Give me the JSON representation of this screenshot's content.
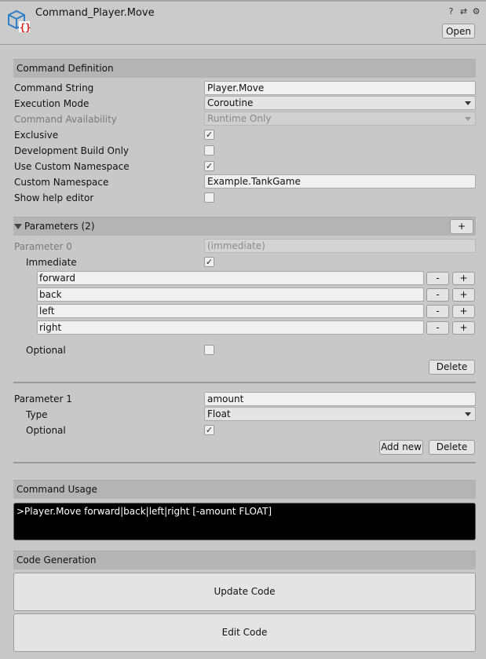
{
  "header": {
    "title": "Command_Player.Move",
    "open_label": "Open",
    "icons": [
      "help-icon",
      "preset-icon",
      "settings-icon"
    ]
  },
  "definition": {
    "section_title": "Command Definition",
    "command_string": {
      "label": "Command String",
      "value": "Player.Move"
    },
    "execution_mode": {
      "label": "Execution Mode",
      "value": "Coroutine"
    },
    "availability": {
      "label": "Command Availability",
      "value": "Runtime Only"
    },
    "exclusive": {
      "label": "Exclusive",
      "checked": true
    },
    "dev_build": {
      "label": "Development Build Only",
      "checked": false
    },
    "use_custom_ns": {
      "label": "Use Custom Namespace",
      "checked": true
    },
    "custom_ns": {
      "label": "Custom Namespace",
      "value": "Example.TankGame"
    },
    "show_help": {
      "label": "Show help editor",
      "checked": false
    }
  },
  "parameters": {
    "section_title": "Parameters (2)",
    "add_label": "+",
    "param0": {
      "label": "Parameter 0",
      "value": "(immediate)",
      "immediate_label": "Immediate",
      "immediate_checked": true,
      "options": [
        "forward",
        "back",
        "left",
        "right"
      ],
      "minus_label": "-",
      "plus_label": "+",
      "optional_label": "Optional",
      "optional_checked": false,
      "delete_label": "Delete"
    },
    "param1": {
      "label": "Parameter 1",
      "value": "amount",
      "type_label": "Type",
      "type_value": "Float",
      "optional_label": "Optional",
      "optional_checked": true,
      "add_new_label": "Add new",
      "delete_label": "Delete"
    }
  },
  "usage": {
    "section_title": "Command Usage",
    "text": ">Player.Move forward|back|left|right [-amount FLOAT]"
  },
  "codegen": {
    "section_title": "Code Generation",
    "update_label": "Update Code",
    "edit_label": "Edit Code"
  },
  "check_glyph": "✓"
}
